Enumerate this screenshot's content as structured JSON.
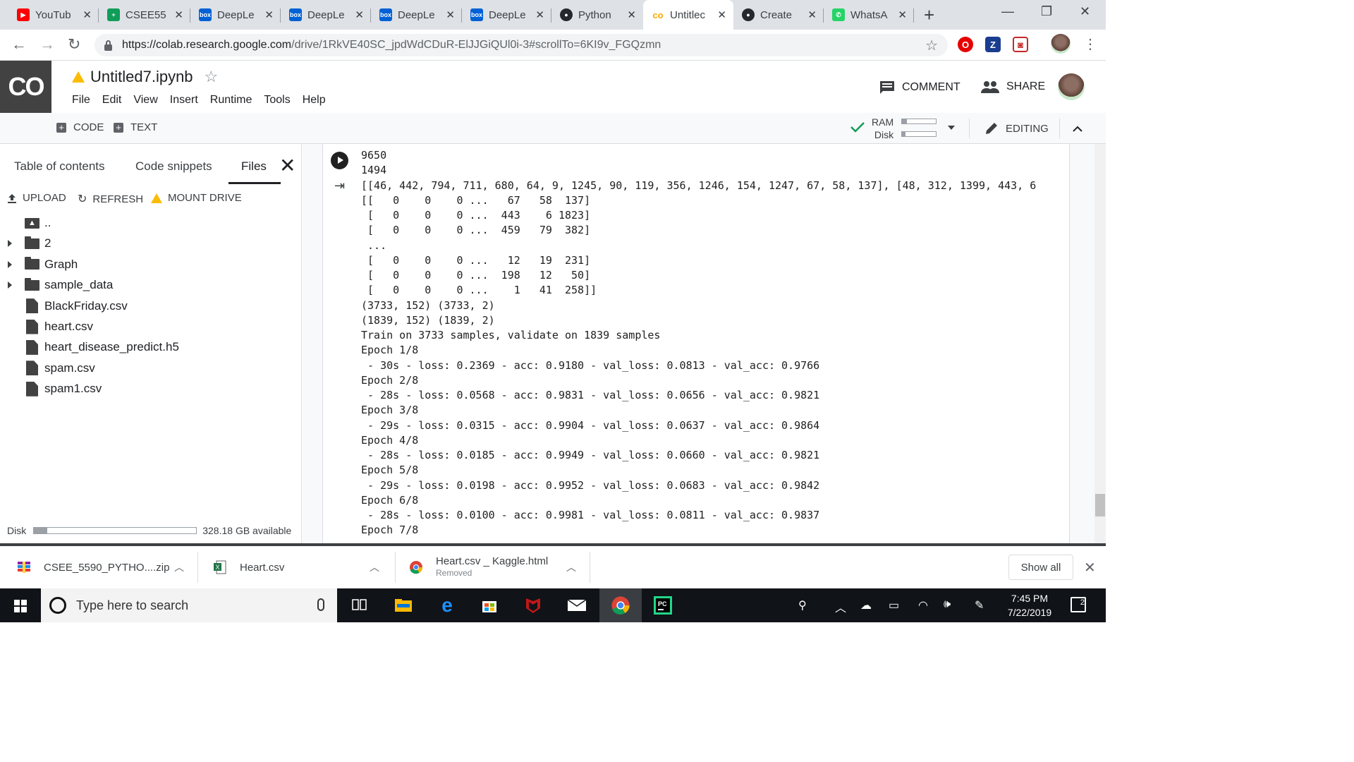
{
  "browser": {
    "tabs": [
      {
        "label": "YouTub",
        "favicon": "youtube-icon",
        "color": "#ff0000",
        "glyph": "▶"
      },
      {
        "label": "CSEE55",
        "favicon": "sheets-icon",
        "color": "#0f9d58",
        "glyph": "+"
      },
      {
        "label": "DeepLe",
        "favicon": "box-icon",
        "color": "#0061d5",
        "glyph": "box"
      },
      {
        "label": "DeepLe",
        "favicon": "box-icon",
        "color": "#0061d5",
        "glyph": "box"
      },
      {
        "label": "DeepLe",
        "favicon": "box-icon",
        "color": "#0061d5",
        "glyph": "box"
      },
      {
        "label": "DeepLe",
        "favicon": "box-icon",
        "color": "#0061d5",
        "glyph": "box"
      },
      {
        "label": "Python",
        "favicon": "github-icon",
        "color": "#24292e",
        "glyph": "●"
      },
      {
        "label": "Untitlec",
        "favicon": "colab-icon",
        "color": "#f9ab00",
        "glyph": "co"
      },
      {
        "label": "Create",
        "favicon": "github-icon",
        "color": "#24292e",
        "glyph": "●"
      },
      {
        "label": "WhatsA",
        "favicon": "whatsapp-icon",
        "color": "#25d366",
        "glyph": "✆"
      }
    ],
    "active_tab": 7,
    "url_host": "https://colab.research.google.com",
    "url_path": "/drive/1RkVE40SC_jpdWdCDuR-ElJJGiQUl0i-3#scrollTo=6KI9v_FGQzmn",
    "extensions": [
      {
        "name": "opera-ext-icon",
        "glyph": "O",
        "color": "#e60000"
      },
      {
        "name": "z-ext-icon",
        "glyph": "Z",
        "color": "#1a3d8f"
      },
      {
        "name": "pocket-ext-icon",
        "glyph": "◙",
        "color": "#c62828"
      }
    ]
  },
  "colab": {
    "logo": "CO",
    "notebook_title": "Untitled7.ipynb",
    "menu": [
      "File",
      "Edit",
      "View",
      "Insert",
      "Runtime",
      "Tools",
      "Help"
    ],
    "comment_label": "COMMENT",
    "share_label": "SHARE",
    "toolbar": {
      "code_label": "CODE",
      "text_label": "TEXT",
      "ram_label": "RAM",
      "disk_label": "Disk",
      "ram_usage": 0.15,
      "disk_usage": 0.1,
      "editing_label": "EDITING"
    }
  },
  "sidebar": {
    "tabs": [
      "Table of contents",
      "Code snippets",
      "Files"
    ],
    "active_tab": 2,
    "actions": {
      "upload": "UPLOAD",
      "refresh": "REFRESH",
      "mount": "MOUNT DRIVE"
    },
    "tree": [
      {
        "name": "..",
        "type": "parent"
      },
      {
        "name": "2",
        "type": "folder"
      },
      {
        "name": "Graph",
        "type": "folder"
      },
      {
        "name": "sample_data",
        "type": "folder"
      },
      {
        "name": "BlackFriday.csv",
        "type": "file"
      },
      {
        "name": "heart.csv",
        "type": "file"
      },
      {
        "name": "heart_disease_predict.h5",
        "type": "file"
      },
      {
        "name": "spam.csv",
        "type": "file"
      },
      {
        "name": "spam1.csv",
        "type": "file"
      }
    ],
    "disk_label": "Disk",
    "disk_usage": 0.08,
    "disk_available": "328.18 GB available"
  },
  "output": {
    "lines": [
      "9650",
      "1494",
      "[[46, 442, 794, 711, 680, 64, 9, 1245, 90, 119, 356, 1246, 154, 1247, 67, 58, 137], [48, 312, 1399, 443, 6",
      "[[   0    0    0 ...   67   58  137]",
      " [   0    0    0 ...  443    6 1823]",
      " [   0    0    0 ...  459   79  382]",
      " ...",
      " [   0    0    0 ...   12   19  231]",
      " [   0    0    0 ...  198   12   50]",
      " [   0    0    0 ...    1   41  258]]",
      "(3733, 152) (3733, 2)",
      "(1839, 152) (1839, 2)",
      "Train on 3733 samples, validate on 1839 samples",
      "Epoch 1/8",
      " - 30s - loss: 0.2369 - acc: 0.9180 - val_loss: 0.0813 - val_acc: 0.9766",
      "Epoch 2/8",
      " - 28s - loss: 0.0568 - acc: 0.9831 - val_loss: 0.0656 - val_acc: 0.9821",
      "Epoch 3/8",
      " - 29s - loss: 0.0315 - acc: 0.9904 - val_loss: 0.0637 - val_acc: 0.9864",
      "Epoch 4/8",
      " - 28s - loss: 0.0185 - acc: 0.9949 - val_loss: 0.0660 - val_acc: 0.9821",
      "Epoch 5/8",
      " - 29s - loss: 0.0198 - acc: 0.9952 - val_loss: 0.0683 - val_acc: 0.9842",
      "Epoch 6/8",
      " - 28s - loss: 0.0100 - acc: 0.9981 - val_loss: 0.0811 - val_acc: 0.9837",
      "Epoch 7/8"
    ]
  },
  "downloads": [
    {
      "name": "CSEE_5590_PYTHO....zip",
      "icon": "zip-archive-icon",
      "status": ""
    },
    {
      "name": "Heart.csv",
      "icon": "excel-file-icon",
      "status": ""
    },
    {
      "name": "Heart.csv _ Kaggle.html",
      "icon": "chrome-file-icon",
      "status": "Removed"
    }
  ],
  "downloads_show_all": "Show all",
  "taskbar": {
    "search_placeholder": "Type here to search",
    "time": "7:45 PM",
    "date": "7/22/2019",
    "notifications": "2"
  }
}
